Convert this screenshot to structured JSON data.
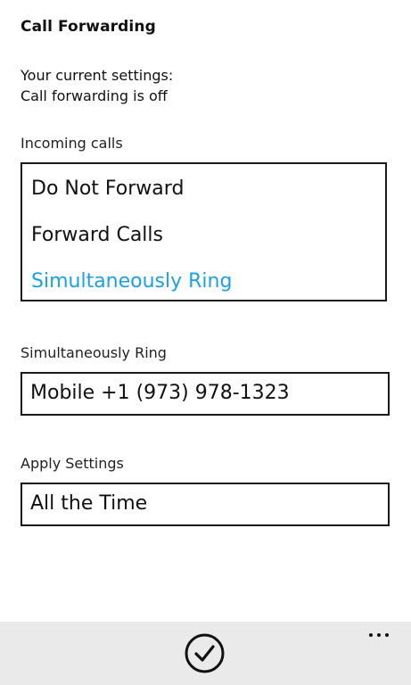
{
  "page": {
    "title": "Call Forwarding"
  },
  "current_settings": {
    "heading": "Your current settings:",
    "status": "Call forwarding is off"
  },
  "incoming_calls": {
    "label": "Incoming calls",
    "options": [
      {
        "label": "Do Not Forward",
        "selected": false
      },
      {
        "label": "Forward Calls",
        "selected": false
      },
      {
        "label": "Simultaneously Ring",
        "selected": true
      }
    ]
  },
  "simultaneous_ring": {
    "label": "Simultaneously Ring",
    "value": "Mobile +1 (973) 978-1323"
  },
  "apply_settings": {
    "label": "Apply Settings",
    "value": "All the Time"
  },
  "app_bar": {
    "confirm_icon": "check-circle-icon",
    "more_icon": "ellipsis-icon"
  },
  "colors": {
    "accent": "#1ba1e2",
    "app_bar_bg": "#eaeaea",
    "text": "#111111"
  }
}
